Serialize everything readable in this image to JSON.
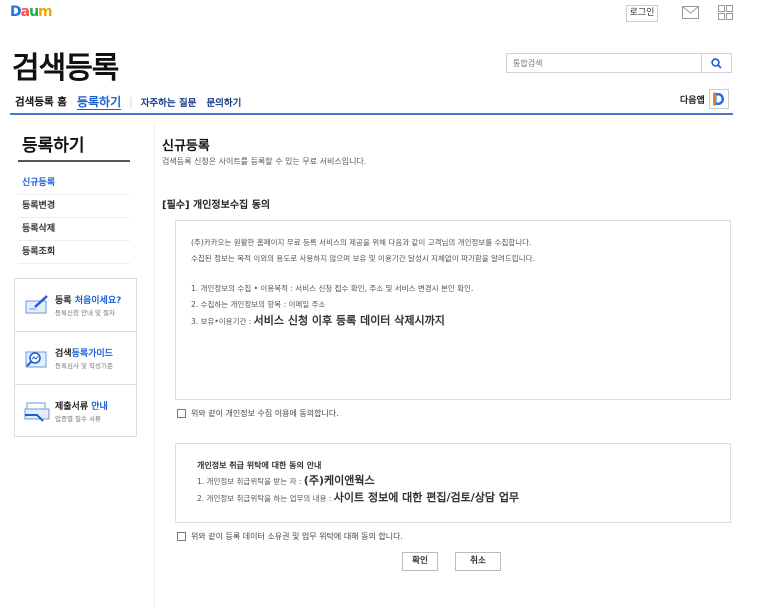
{
  "topbar": {
    "logo": [
      "D",
      "a",
      "u",
      "m"
    ],
    "login_label": "로그인"
  },
  "header": {
    "site_title": "검색등록",
    "search_placeholder": "통합검색",
    "nav": {
      "home": "검색등록 홈",
      "active": "등록하기",
      "sep": "|",
      "faq": "자주하는 질문",
      "inquiry": "문의하기"
    },
    "daum_app_label": "다음앱"
  },
  "sidebar": {
    "title": "등록하기",
    "items": [
      {
        "label": "신규등록"
      },
      {
        "label": "등록변경"
      },
      {
        "label": "등록삭제"
      },
      {
        "label": "등록조회"
      }
    ],
    "banners": [
      {
        "title_a": "등록 ",
        "title_b": "처음이세요?",
        "sub": "등록신청 안내 및 절차"
      },
      {
        "title_a": "검색",
        "title_b": "등록가이드",
        "sub": "등록심사 및 작성기준"
      },
      {
        "title_a": "제출서류 ",
        "title_b": "안내",
        "sub": "업종별 필수 서류"
      }
    ]
  },
  "main": {
    "title": "신규등록",
    "description": "검색등록 신청은 사이트를 등록할 수 있는 무료 서비스입니다.",
    "section_title": "[필수] 개인정보수집 동의",
    "privacy": {
      "line1": "(주)카카오는 원활한 홈페이지 무료 등록 서비스의 제공을 위해 다음과 같이 고객님의 개인정보를 수집합니다.",
      "line2": "수집된 정보는 목적 이외의 용도로 사용하지 않으며 보유 및 이용기간 달성시 지체없이 파기함을 알려드립니다.",
      "item1": "1. 개인정보의 수집 • 이용목적 : 서비스 신청 접수 확인,  주소 및 서비스 변경시 본인 확인.",
      "item2": "2. 수집하는 개인정보의 항목 : 이메일 주소",
      "item3_prefix": "3. 보유•이용기간 : ",
      "item3_strong": "서비스 신청 이후 등록 데이터 삭제시까지"
    },
    "agree1": "위와 같이 개인정보 수집 이용에 동의합니다.",
    "consign": {
      "heading": "개인정보 취급 위탁에 대한 동의 안내",
      "line1_prefix": "1. 개인정보 취급위탁을 받는 자 : ",
      "line1_strong": "(주)케이앤웍스",
      "line2_prefix": "2. 개인정보 취급위탁을 하는 업무의 내용 : ",
      "line2_strong": "사이트 정보에 대한 편집/검토/상담 업무"
    },
    "agree2": "위와 같이 등록 데이터 소유권 및 업무 위탁에 대해 동의 합니다.",
    "confirm_label": "확인",
    "cancel_label": "취소"
  }
}
